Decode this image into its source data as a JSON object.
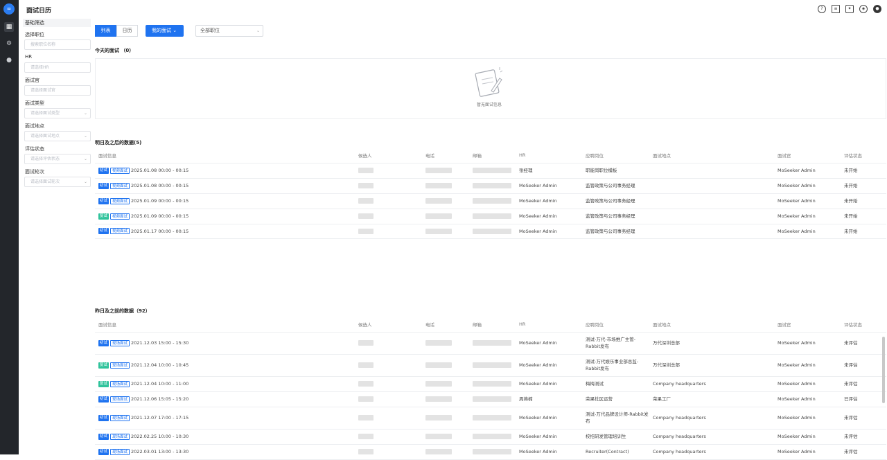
{
  "app": {
    "title": "面试日历"
  },
  "nav": {
    "logo": "logo-icon",
    "items": [
      "calendar-icon",
      "user-gear-icon",
      "user-icon"
    ]
  },
  "top_icons": [
    "help-icon",
    "document-icon",
    "puzzle-icon",
    "compass-icon",
    "account-icon"
  ],
  "filters": {
    "header": "基础筛选",
    "fields": [
      {
        "label": "选择职位",
        "placeholder": "搜索职位名称",
        "type": "input"
      },
      {
        "label": "HR",
        "placeholder": "请选择HR",
        "type": "input"
      },
      {
        "label": "面试官",
        "placeholder": "请选择面试官",
        "type": "input"
      },
      {
        "label": "面试类型",
        "placeholder": "请选择面试类型",
        "type": "select"
      },
      {
        "label": "面试地点",
        "placeholder": "请选择面试地点",
        "type": "select"
      },
      {
        "label": "评估状态",
        "placeholder": "请选择评估状态",
        "type": "select"
      },
      {
        "label": "面试轮次",
        "placeholder": "请选择面试轮次",
        "type": "select"
      }
    ]
  },
  "toolbar": {
    "view_list": "列表",
    "view_calendar": "日历",
    "mine": "我的面试",
    "position": "全部职位"
  },
  "today": {
    "title": "今天的面试 （0）",
    "empty": "暂无面试信息"
  },
  "columns": [
    "面试信息",
    "候选人",
    "电话",
    "邮箱",
    "HR",
    "应聘岗位",
    "面试地点",
    "面试官",
    "评估状态"
  ],
  "future": {
    "title": "明日及之后的数据(5)",
    "rows": [
      {
        "round": "初试",
        "kind": "视频面试",
        "time": "2025.01.08 00:00 - 00:15",
        "hr": "张经理",
        "job": "职能岗职位模板",
        "place": "",
        "interviewer": "MoSeeker Admin",
        "status": "未开始"
      },
      {
        "round": "初试",
        "kind": "视频面试",
        "time": "2025.01.08 00:00 - 00:15",
        "hr": "MoSeeker Admin",
        "job": "监管政策与公司事务经理",
        "place": "",
        "interviewer": "MoSeeker Admin",
        "status": "未开始"
      },
      {
        "round": "初试",
        "kind": "视频面试",
        "time": "2025.01.09 00:00 - 00:15",
        "hr": "MoSeeker Admin",
        "job": "监管政策与公司事务经理",
        "place": "",
        "interviewer": "MoSeeker Admin",
        "status": "未开始"
      },
      {
        "round": "复试",
        "kind": "视频面试",
        "time": "2025.01.09 00:00 - 00:15",
        "hr": "MoSeeker Admin",
        "job": "监管政策与公司事务经理",
        "place": "",
        "interviewer": "MoSeeker Admin",
        "status": "未开始"
      },
      {
        "round": "初试",
        "kind": "视频面试",
        "time": "2025.01.17 00:00 - 00:15",
        "hr": "MoSeeker Admin",
        "job": "监管政策与公司事务经理",
        "place": "",
        "interviewer": "MoSeeker Admin",
        "status": "未开始"
      }
    ]
  },
  "past": {
    "title": "昨日及之前的数据（92）",
    "rows": [
      {
        "round": "初试",
        "kind": "现场面试",
        "time": "2021.12.03 15:00 - 15:30",
        "hr": "MoSeeker Admin",
        "job": "测试-万代-市场推广主管-Rabbit发布",
        "place": "万代深圳总部",
        "interviewer": "MoSeeker Admin",
        "status": "未评估"
      },
      {
        "round": "复试",
        "kind": "现场面试",
        "time": "2021.12.04 10:00 - 10:45",
        "hr": "MoSeeker Admin",
        "job": "测试-万代娱乐事业部总监-Rabbit发布",
        "place": "万代深圳总部",
        "interviewer": "MoSeeker Admin",
        "status": "未评估"
      },
      {
        "round": "复试",
        "kind": "现场面试",
        "time": "2021.12.04 10:00 - 11:00",
        "hr": "MoSeeker Admin",
        "job": "梅梅测试",
        "place": "Company headquarters",
        "interviewer": "MoSeeker Admin",
        "status": "未评估"
      },
      {
        "round": "初试",
        "kind": "现场面试",
        "time": "2021.12.06 15:05 - 15:20",
        "hr": "周燕楠",
        "job": "荣果社区运营",
        "place": "荣果工厂",
        "interviewer": "MoSeeker Admin",
        "status": "已评估"
      },
      {
        "round": "初试",
        "kind": "现场面试",
        "time": "2021.12.07 17:00 - 17:15",
        "hr": "MoSeeker Admin",
        "job": "测试-万代品牌设计师-Rabbit发布",
        "place": "Company headquarters",
        "interviewer": "MoSeeker Admin",
        "status": "未评估"
      },
      {
        "round": "初试",
        "kind": "现场面试",
        "time": "2022.02.25 10:00 - 10:30",
        "hr": "MoSeeker Admin",
        "job": "校招研发管理培训生",
        "place": "Company headquarters",
        "interviewer": "MoSeeker Admin",
        "status": "未评估"
      },
      {
        "round": "初试",
        "kind": "现场面试",
        "time": "2022.03.01 13:00 - 13:30",
        "hr": "MoSeeker Admin",
        "job": "Recruiter(Contract)",
        "place": "Company headquarters",
        "interviewer": "MoSeeker Admin",
        "status": "未评估"
      }
    ]
  }
}
